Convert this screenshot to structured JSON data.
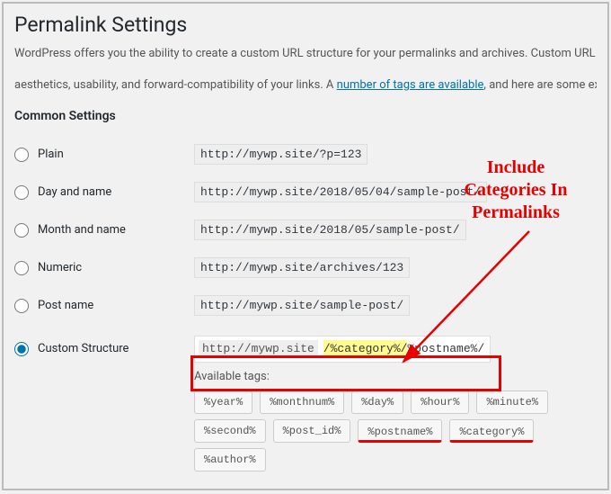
{
  "page_title": "Permalink Settings",
  "intro_pre": "WordPress offers you the ability to create a custom URL structure for your permalinks and archives. Custom URL structures can im",
  "intro_mid": "aesthetics, usability, and forward-compatibility of your links. A ",
  "intro_link": "number of tags are available",
  "intro_post": ", and here are some examples to get y",
  "section": "Common Settings",
  "options": {
    "plain": {
      "label": "Plain",
      "example": "http://mywp.site/?p=123"
    },
    "dayname": {
      "label": "Day and name",
      "example": "http://mywp.site/2018/05/04/sample-post/"
    },
    "monname": {
      "label": "Month and name",
      "example": "http://mywp.site/2018/05/sample-post/"
    },
    "numeric": {
      "label": "Numeric",
      "example": "http://mywp.site/archives/123"
    },
    "postnm": {
      "label": "Post name",
      "example": "http://mywp.site/sample-post/"
    },
    "custom": {
      "label": "Custom Structure"
    }
  },
  "custom": {
    "prefix": "http://mywp.site",
    "value_hl": "/%category%/",
    "value_rest": "%postname%/"
  },
  "available_label": "Available tags:",
  "tags": [
    "%year%",
    "%monthnum%",
    "%day%",
    "%hour%",
    "%minute%",
    "%second%",
    "%post_id%",
    "%postname%",
    "%category%",
    "%author%"
  ],
  "callout": "Include Categories In Permalinks"
}
